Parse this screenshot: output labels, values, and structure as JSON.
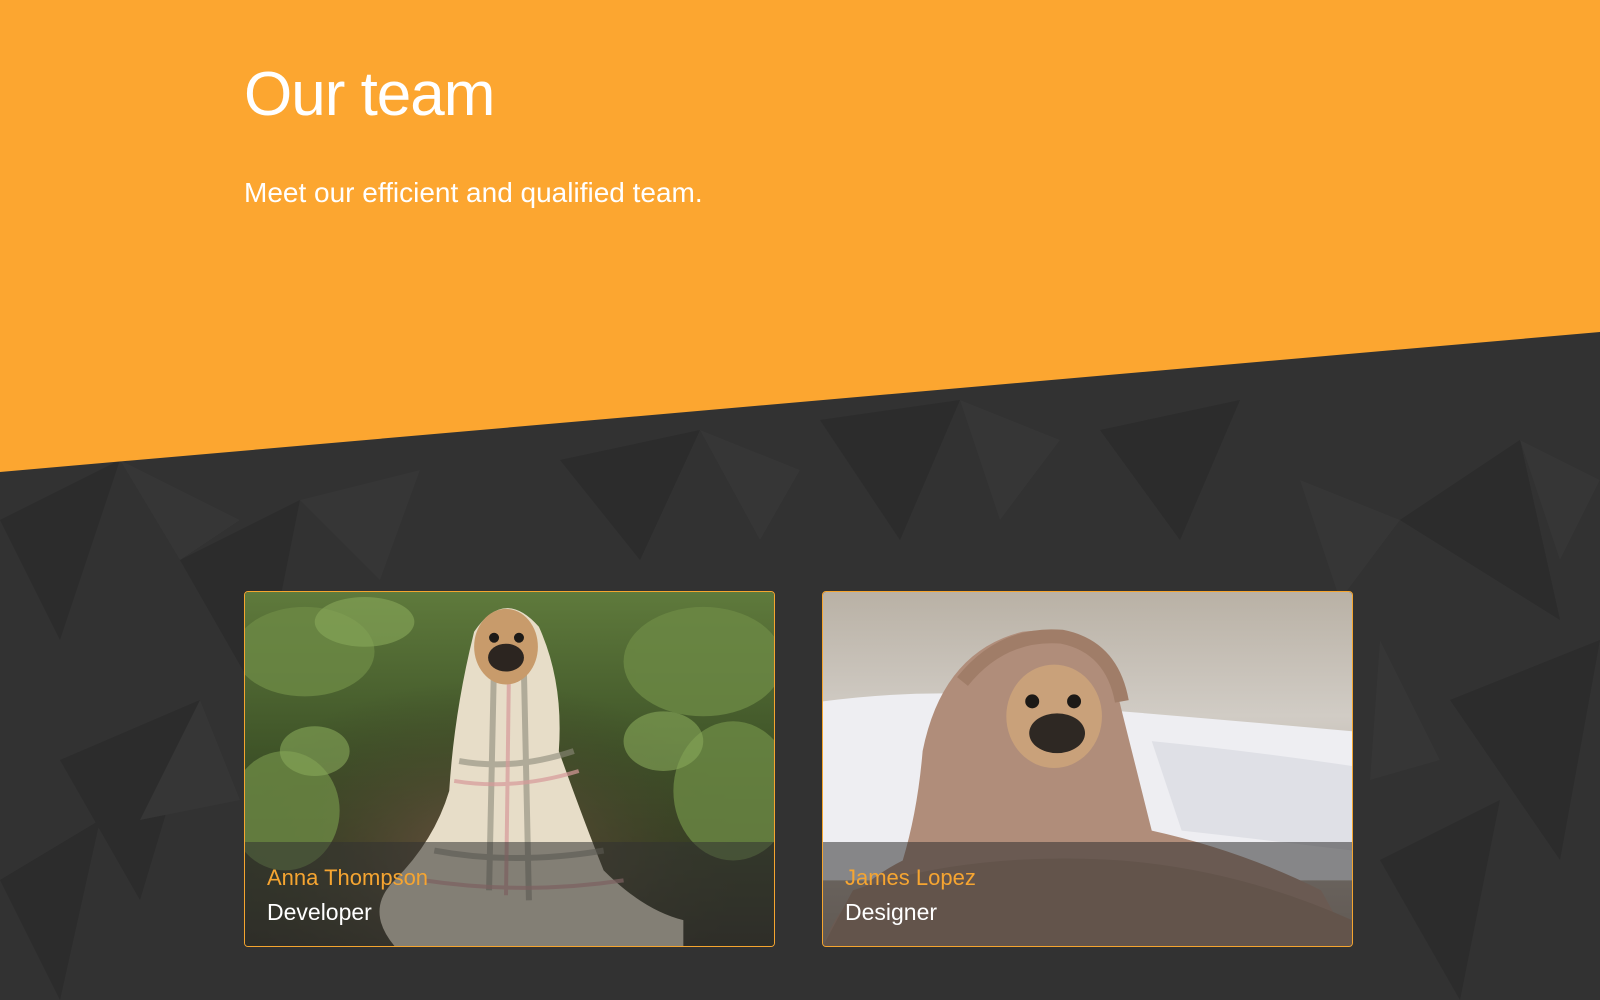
{
  "hero": {
    "title": "Our team",
    "subtitle": "Meet our efficient and qualified team."
  },
  "team": {
    "members": [
      {
        "name": "Anna Thompson",
        "role": "Developer",
        "photo": "pug wrapped in plaid blanket on forest path"
      },
      {
        "name": "James Lopez",
        "role": "Designer",
        "photo": "pug wrapped in tan blanket on bed"
      }
    ]
  },
  "colors": {
    "accent": "#fca630",
    "dark_bg": "#323232",
    "text": "#ffffff",
    "name_text": "#f6a531"
  }
}
